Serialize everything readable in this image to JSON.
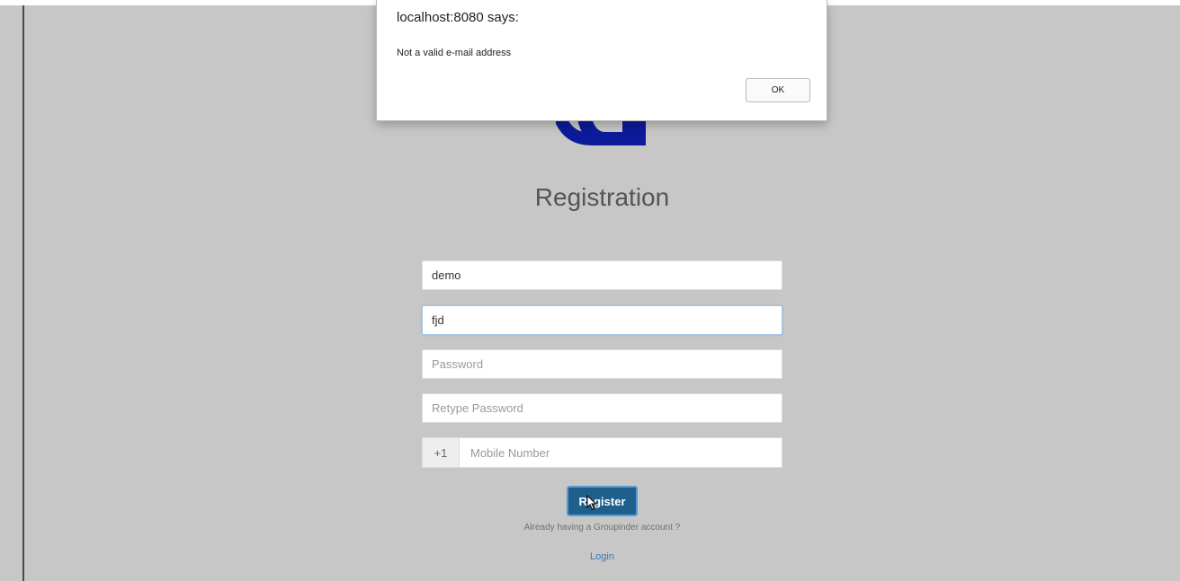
{
  "alert": {
    "title": "localhost:8080 says:",
    "message": "Not a valid e-mail address",
    "ok_label": "OK"
  },
  "page": {
    "title": "Registration",
    "logo_icon": "groupinder-logo-icon",
    "brand_color": "#0d1b9a"
  },
  "form": {
    "name_value": "demo",
    "email_value": "fjd",
    "password_placeholder": "Password",
    "retype_placeholder": "Retype Password",
    "country_code": "+1",
    "mobile_placeholder": "Mobile Number",
    "register_label": "Register",
    "register_color": "#1f5f8b"
  },
  "footer": {
    "hint": "Already having a Groupinder account ?",
    "login_label": "Login"
  }
}
